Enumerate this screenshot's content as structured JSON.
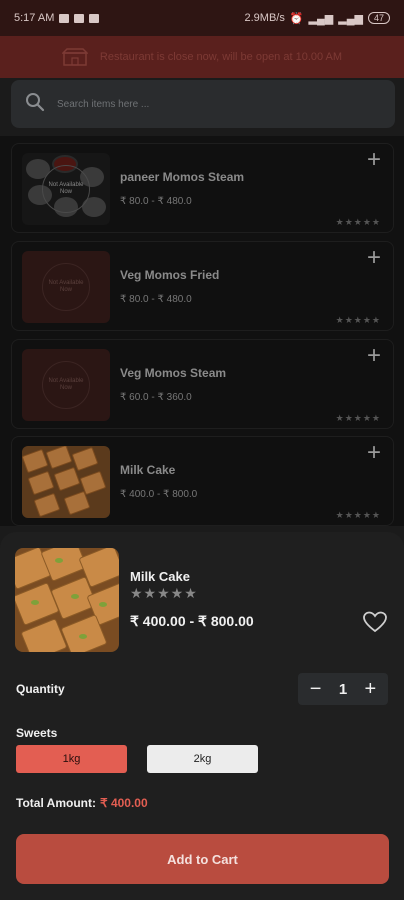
{
  "status_bar": {
    "time": "5:17 AM",
    "network_speed": "2.9MB/s",
    "battery": "47"
  },
  "banner": {
    "icon": "storefront-icon",
    "text": "Restaurant is close now, will be open at 10.00 AM"
  },
  "search": {
    "icon": "search-icon",
    "placeholder": "Search items here ..."
  },
  "items": [
    {
      "name": "paneer Momos Steam",
      "price": "₹ 80.0 - ₹ 480.0",
      "thumb": "momos-photo",
      "badge": "Not Available Now",
      "rating": 0
    },
    {
      "name": "Veg Momos Fried",
      "price": "₹ 80.0 - ₹ 480.0",
      "thumb": "not-available",
      "badge": "Not Available Now",
      "rating": 0
    },
    {
      "name": "Veg Momos Steam",
      "price": "₹ 60.0 - ₹ 360.0",
      "thumb": "not-available",
      "badge": "Not Available Now",
      "rating": 0
    },
    {
      "name": "Milk Cake",
      "price": "₹ 400.0 - ₹ 800.0",
      "thumb": "milk-cake-photo",
      "badge": "",
      "rating": 0
    }
  ],
  "detail": {
    "name": "Milk Cake",
    "rating": 0,
    "price": "₹ 400.00 - ₹ 800.00",
    "quantity_label": "Quantity",
    "quantity": "1",
    "variant_group": "Sweets",
    "options": [
      "1kg",
      "2kg"
    ],
    "selected_option": "1kg",
    "total_label": "Total Amount:",
    "total_value": "₹ 400.00",
    "cta": "Add to Cart"
  },
  "colors": {
    "accent": "#e35e52",
    "cta": "#b94c3f",
    "banner": "#5a201d",
    "background": "#1b1b1b"
  }
}
